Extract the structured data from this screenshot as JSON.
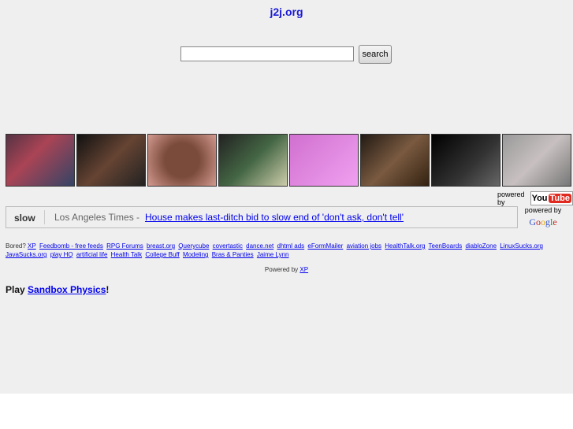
{
  "header": {
    "title": "j2j.org"
  },
  "search": {
    "value": "",
    "button": "search"
  },
  "thumbnails": [
    {
      "color": "linear-gradient(135deg,#553344,#aa4455 40%,#334466)"
    },
    {
      "color": "linear-gradient(135deg,#111,#664433 50%,#222)"
    },
    {
      "color": "radial-gradient(circle,#7a4a3a 40%,#d39a90)"
    },
    {
      "color": "linear-gradient(135deg,#222,#446644 50%,#ccccaa)"
    },
    {
      "color": "linear-gradient(135deg,#d070d0,#f0a0f0)"
    },
    {
      "color": "linear-gradient(135deg,#221a14,#7a5a40 50%,#332211)"
    },
    {
      "color": "linear-gradient(135deg,#000,#333 60%,#666)"
    },
    {
      "color": "linear-gradient(135deg,#999,#c8c0c0 50%,#777)"
    }
  ],
  "youtube": {
    "powered_by": "powered by",
    "logo_you": "You",
    "logo_tube": "Tube"
  },
  "news": {
    "label": "slow",
    "source": "Los Angeles Times -",
    "headline": "House makes last-ditch bid to slow end of 'don't ask, don't tell'"
  },
  "google": {
    "powered_by": "powered by",
    "logo": "Google"
  },
  "links": {
    "prefix": "Bored?",
    "items": [
      "XP",
      "Feedbomb - free feeds",
      "RPG Forums",
      "breast.org",
      "Querycube",
      "covertastic",
      "dance.net",
      "dhtml ads",
      "eFormMailer",
      "aviation jobs",
      "HealthTalk.org",
      "TeenBoards",
      "diabloZone",
      "LinuxSucks.org",
      "JavaSucks.org",
      "play HQ",
      "artificial life",
      "Health Talk",
      "College Buff",
      "Modeling",
      "Bras & Panties",
      "Jaime Lynn"
    ]
  },
  "powered": {
    "text": "Powered by",
    "link": "XP"
  },
  "play": {
    "prefix": "Play",
    "link": "Sandbox Physics",
    "suffix": "!"
  }
}
